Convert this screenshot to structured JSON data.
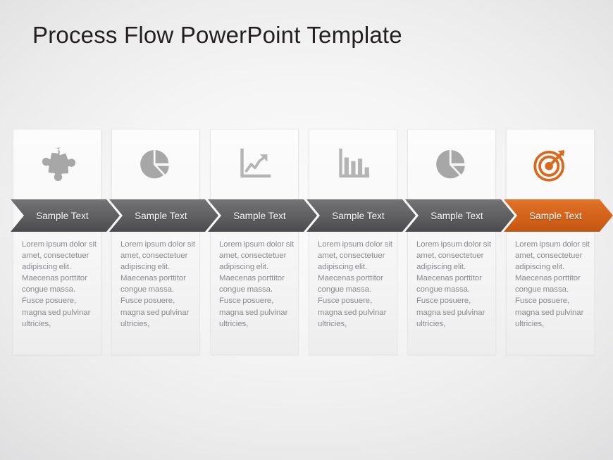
{
  "slide": {
    "title": "Process Flow PowerPoint Template",
    "background_color": "#f2f2f3",
    "accent_color": "#d9691f",
    "gray_color": "#5c5c5f"
  },
  "steps": [
    {
      "icon": "puzzle-piece-icon",
      "label": "Sample Text",
      "body": "Lorem ipsum dolor sit amet, consectetuer adipiscing elit. Maecenas porttitor congue massa. Fusce posuere, magna sed pulvinar ultricies,",
      "accent": false,
      "icon_color": "#a7a7a7"
    },
    {
      "icon": "pie-chart-icon",
      "label": "Sample Text",
      "body": "Lorem ipsum dolor sit amet, consectetuer adipiscing elit. Maecenas porttitor congue massa. Fusce posuere, magna sed pulvinar ultricies,",
      "accent": false,
      "icon_color": "#a7a7a7"
    },
    {
      "icon": "line-chart-icon",
      "label": "Sample Text",
      "body": "Lorem ipsum dolor sit amet, consectetuer adipiscing elit. Maecenas porttitor congue massa. Fusce posuere, magna sed pulvinar ultricies,",
      "accent": false,
      "icon_color": "#b4b4b4"
    },
    {
      "icon": "bar-chart-icon",
      "label": "Sample Text",
      "body": "Lorem ipsum dolor sit amet, consectetuer adipiscing elit. Maecenas porttitor congue massa. Fusce posuere, magna sed pulvinar ultricies,",
      "accent": false,
      "icon_color": "#b4b4b4"
    },
    {
      "icon": "pie-chart-icon",
      "label": "Sample Text",
      "body": "Lorem ipsum dolor sit amet, consectetuer adipiscing elit. Maecenas porttitor congue massa. Fusce posuere, magna sed pulvinar ultricies,",
      "accent": false,
      "icon_color": "#a7a7a7"
    },
    {
      "icon": "target-bullseye-icon",
      "label": "Sample Text",
      "body": "Lorem ipsum dolor sit amet, consectetuer adipiscing elit. Maecenas porttitor congue massa. Fusce posuere, magna sed pulvinar ultricies,",
      "accent": true,
      "icon_color": "#d9691f"
    }
  ]
}
